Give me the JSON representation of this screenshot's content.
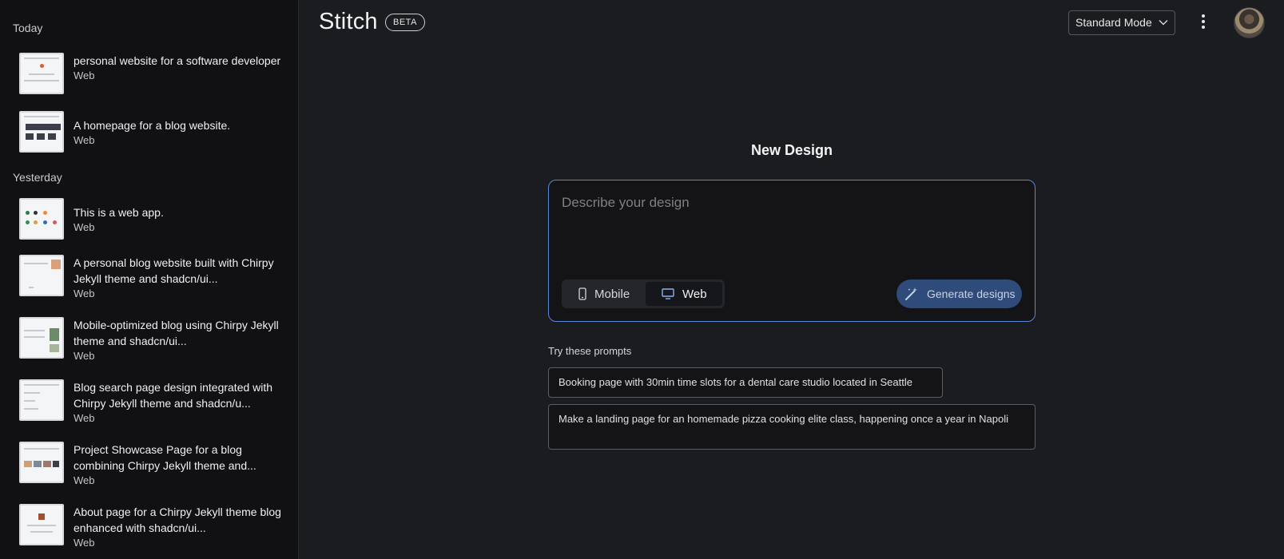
{
  "sidebar": {
    "sections": [
      {
        "label": "Today"
      },
      {
        "label": "Yesterday"
      }
    ],
    "items": [
      {
        "title": "personal website for a software developer",
        "type": "Web"
      },
      {
        "title": "A homepage for a blog website.",
        "type": "Web"
      },
      {
        "title": "This is a web app.",
        "type": "Web"
      },
      {
        "title": "A personal blog website built with Chirpy Jekyll theme and shadcn/ui...",
        "type": "Web"
      },
      {
        "title": "Mobile-optimized blog using Chirpy Jekyll theme and shadcn/ui...",
        "type": "Web"
      },
      {
        "title": "Blog search page design integrated with Chirpy Jekyll theme and shadcn/u...",
        "type": "Web"
      },
      {
        "title": "Project Showcase Page for a blog combining Chirpy Jekyll theme and...",
        "type": "Web"
      },
      {
        "title": "About page for a Chirpy Jekyll theme blog enhanced with shadcn/ui...",
        "type": "Web"
      }
    ]
  },
  "header": {
    "logo": "Stitch",
    "badge": "BETA",
    "mode": "Standard Mode",
    "icons": [
      "chevron-down-icon",
      "more-vertical-icon",
      "avatar"
    ]
  },
  "main": {
    "title": "New Design",
    "input_placeholder": "Describe your design",
    "input_value": "",
    "platform_options": [
      {
        "label": "Mobile",
        "icon": "phone-icon",
        "selected": false
      },
      {
        "label": "Web",
        "icon": "monitor-icon",
        "selected": true
      }
    ],
    "generate_label": "Generate designs",
    "try_label": "Try these prompts",
    "prompts": [
      "Booking page with 30min time slots for a dental care studio located in Seattle",
      "Make a landing page for an homemade pizza cooking elite class, happening once a year in Napoli"
    ]
  },
  "colors": {
    "accent": "#5a86d8",
    "generate_button": "#2f4b7a",
    "background": "#1b1c20",
    "sidebar": "#111113"
  }
}
